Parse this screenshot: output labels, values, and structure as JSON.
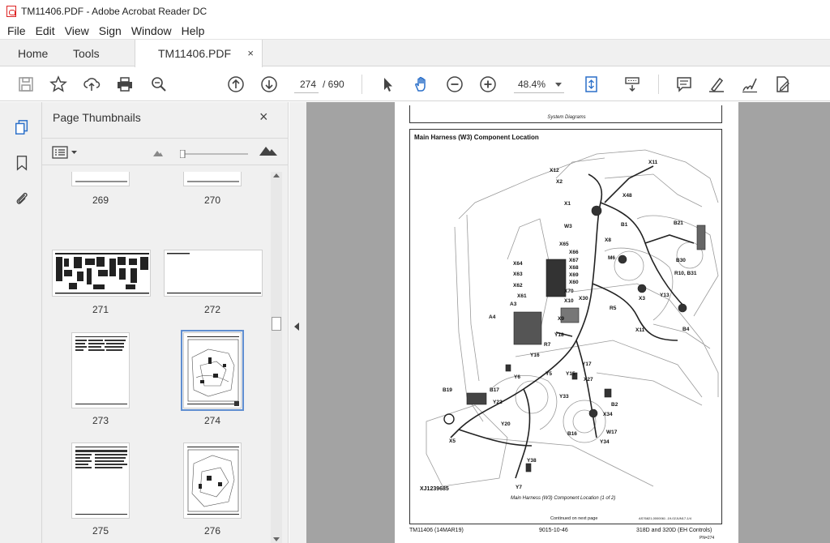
{
  "window": {
    "title": "TM11406.PDF - Adobe Acrobat Reader DC"
  },
  "menu": [
    "File",
    "Edit",
    "View",
    "Sign",
    "Window",
    "Help"
  ],
  "tabs": {
    "home": "Home",
    "tools": "Tools",
    "document": "TM11406.PDF",
    "close": "×"
  },
  "toolbar": {
    "page_current": "274",
    "page_total": "/ 690",
    "zoom": "48.4%",
    "icons": [
      "save-icon",
      "bookmark-star-icon",
      "upload-icon",
      "print-icon",
      "zoom-search-icon",
      "page-up-icon",
      "page-down-icon",
      "select-cursor-icon",
      "hand-icon",
      "zoom-out-icon",
      "zoom-in-icon",
      "fit-page-icon",
      "scroll-mode-icon",
      "comment-icon",
      "highlight-icon",
      "sign-icon",
      "edit-pdf-icon"
    ]
  },
  "panel": {
    "title": "Page Thumbnails",
    "close": "×",
    "thumbnails": [
      {
        "label": "269"
      },
      {
        "label": "270"
      },
      {
        "label": "271"
      },
      {
        "label": "272"
      },
      {
        "label": "273"
      },
      {
        "label": "274",
        "selected": true
      },
      {
        "label": "275"
      },
      {
        "label": "276"
      }
    ]
  },
  "pdf": {
    "header": "System Diagrams",
    "diagram_title": "Main Harness (W3) Component Location",
    "labels": [
      "X11",
      "X12",
      "X2",
      "X48",
      "X1",
      "B21",
      "W3",
      "B1",
      "X8",
      "X65",
      "X66",
      "X64",
      "X67",
      "X68",
      "X63",
      "X69",
      "X60",
      "X62",
      "M6",
      "B30",
      "X70",
      "R10, B31",
      "X61",
      "X10",
      "X30",
      "X3",
      "Y13",
      "A3",
      "R5",
      "A4",
      "X9",
      "X11",
      "B4",
      "Y18",
      "R7",
      "Y16",
      "Y17",
      "Y6",
      "Y5",
      "Y15",
      "X27",
      "B19",
      "B17",
      "Y22",
      "Y33",
      "B2",
      "X34",
      "Y20",
      "W17",
      "B16",
      "X5",
      "Y34",
      "Y38",
      "Y7"
    ],
    "figure_id": "XJ1239685",
    "caption": "Main Harness (W3) Component Location (1 of 2)",
    "continued": "Continued on next page",
    "meta": "AS76821,0000061 -19-02JUN17-1/4",
    "footer_left": "TM11406 (14MAR19)",
    "footer_center": "9015-10-46",
    "footer_right": "318D and 320D (EH Controls)",
    "footer_page": "PN=274"
  }
}
